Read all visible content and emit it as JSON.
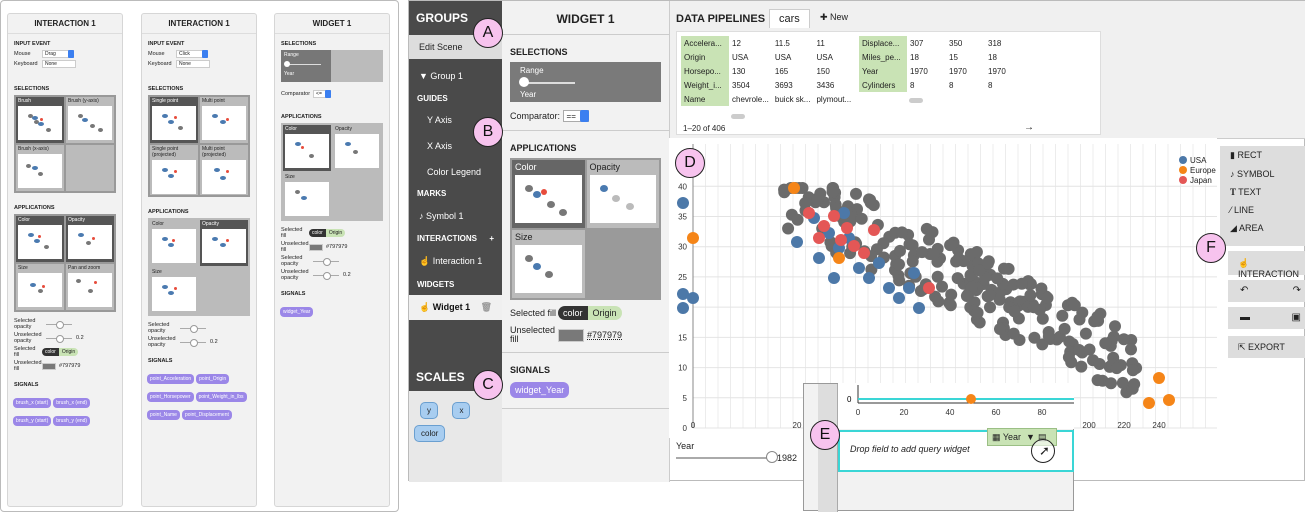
{
  "left_figure": {
    "panel1": {
      "title": "INTERACTION 1",
      "input_event_label": "INPUT EVENT",
      "mouse_label": "Mouse",
      "mouse_value": "Drag",
      "keyboard_label": "Keyboard",
      "keyboard_value": "None",
      "selections_label": "SELECTIONS",
      "selections": [
        "Brush",
        "Brush (y-axis)",
        "Brush (x-axis)"
      ],
      "applications_label": "APPLICATIONS",
      "applications": [
        "Color",
        "Opacity",
        "Size",
        "Pan and zoom"
      ],
      "selected_opacity_label": "Selected opacity",
      "unselected_opacity_label": "Unselected opacity",
      "unselected_opacity_value": "0.2",
      "selected_fill_label": "Selected fill",
      "fill_toggle_on": "color",
      "fill_toggle_off": "Origin",
      "unselected_fill_label": "Unselected fill",
      "unselected_fill_value": "#797979",
      "signals_label": "SIGNALS",
      "signals": [
        "brush_x (start)",
        "brush_x (end)",
        "brush_y (start)",
        "brush_y (end)"
      ]
    },
    "panel2": {
      "title": "INTERACTION 1",
      "input_event_label": "INPUT EVENT",
      "mouse_label": "Mouse",
      "mouse_value": "Click",
      "keyboard_label": "Keyboard",
      "keyboard_value": "None",
      "selections_label": "SELECTIONS",
      "selections": [
        "Single point",
        "Multi point",
        "Single point (projected)",
        "Multi point (projected)"
      ],
      "applications_label": "APPLICATIONS",
      "applications": [
        "Color",
        "Opacity",
        "Size"
      ],
      "selected_opacity_label": "Selected opacity",
      "unselected_opacity_label": "Unselected opacity",
      "unselected_opacity_value": "0.2",
      "signals_label": "SIGNALS",
      "signals": [
        "point_Acceleration",
        "point_Origin",
        "point_Horsepower",
        "point_Weight_in_lbs",
        "point_Name",
        "point_Displacement"
      ]
    },
    "panel3": {
      "title": "WIDGET 1",
      "selections_label": "SELECTIONS",
      "range_label": "Range",
      "year_label": "Year",
      "comparator_label": "Comparator",
      "comparator_value": "<=",
      "applications_label": "APPLICATIONS",
      "applications": [
        "Color",
        "Opacity",
        "Size"
      ],
      "selected_fill_label": "Selected fill",
      "fill_toggle_on": "color",
      "fill_toggle_off": "Origin",
      "unselected_fill_label": "Unselected fill",
      "unselected_fill_value": "#797979",
      "selected_opacity_label": "Selected opacity",
      "unselected_opacity_label": "Unselected opacity",
      "unselected_opacity_value": "0.2",
      "signals_label": "SIGNALS",
      "signals": [
        "widget_Year"
      ]
    }
  },
  "groups": {
    "header": "GROUPS",
    "edit_scene": "Edit Scene",
    "group1": "▼  Group 1",
    "guides_label": "GUIDES",
    "guides": [
      "Y Axis",
      "X Axis",
      "Color Legend"
    ],
    "marks_label": "MARKS",
    "symbol": "Symbol 1",
    "interactions_label": "INTERACTIONS",
    "interactions_plus": "+",
    "interaction": "Interaction 1",
    "widgets_label": "WIDGETS",
    "widget": "Widget 1"
  },
  "scales": {
    "header": "SCALES",
    "chips": [
      "y",
      "x",
      "color"
    ]
  },
  "widget_panel": {
    "title": "WIDGET 1",
    "selections_label": "SELECTIONS",
    "range_label": "Range",
    "year_label": "Year",
    "comparator_label": "Comparator:",
    "comparator_value": "==",
    "applications_label": "APPLICATIONS",
    "applications": [
      "Color",
      "Opacity",
      "Size"
    ],
    "selected_fill_label": "Selected fill",
    "fill_toggle_on": "color",
    "fill_toggle_off": "Origin",
    "unselected_fill_label": "Unselected fill",
    "unselected_fill_value": "#797979",
    "signals_label": "SIGNALS",
    "signal": "widget_Year"
  },
  "data_pipelines": {
    "title": "DATA PIPELINES",
    "tab": "cars",
    "new_label": "✚ New",
    "table1": [
      [
        "Accelera...",
        "12",
        "11.5",
        "11"
      ],
      [
        "Origin",
        "USA",
        "USA",
        "USA"
      ],
      [
        "Horsepo...",
        "130",
        "165",
        "150"
      ],
      [
        "Weight_i...",
        "3504",
        "3693",
        "3436"
      ],
      [
        "Name",
        "chevrole...",
        "buick sk...",
        "plymout..."
      ]
    ],
    "table2": [
      [
        "Displace...",
        "307",
        "350",
        "318"
      ],
      [
        "Miles_pe...",
        "18",
        "15",
        "18"
      ],
      [
        "Year",
        "1970",
        "1970",
        "1970"
      ],
      [
        "Cylinders",
        "8",
        "8",
        "8"
      ]
    ],
    "pager": "1–20 of 406",
    "next_arrow": "→"
  },
  "chart_data": {
    "type": "scatter",
    "x_ticks": [
      "0",
      "20",
      "40"
    ],
    "y_ticks": [
      "0",
      "5",
      "10",
      "15",
      "20",
      "25",
      "30",
      "35",
      "40"
    ],
    "xlim": [
      0,
      50
    ],
    "ylim": [
      0,
      47
    ],
    "legend": [
      {
        "name": "USA",
        "color": "#4c78a8"
      },
      {
        "name": "Europe",
        "color": "#f58518"
      },
      {
        "name": "Japan",
        "color": "#e45756"
      }
    ],
    "grid": true,
    "legend_position": "top-right"
  },
  "year_widget": {
    "label": "Year",
    "value": "1982",
    "fraction": 1.0
  },
  "marks_toolbar": {
    "items": [
      "RECT",
      "SYMBOL",
      "TEXT",
      "LINE",
      "AREA"
    ],
    "icons": [
      "bar-chart-icon",
      "music-note-icon",
      "text-icon",
      "line-icon",
      "area-icon"
    ],
    "interaction": "INTERACTION",
    "undo": "↶",
    "redo": "↷",
    "export": "EXPORT"
  },
  "popup": {
    "x_ticks": [
      "0",
      "20",
      "40",
      "60",
      "80"
    ],
    "y_tick": "0",
    "x_ticks_main": [
      "200",
      "220",
      "240"
    ],
    "drop_text": "Drop field to add query widget",
    "year_chip": "Year"
  },
  "callouts": [
    "A",
    "B",
    "C",
    "D",
    "E",
    "F"
  ]
}
